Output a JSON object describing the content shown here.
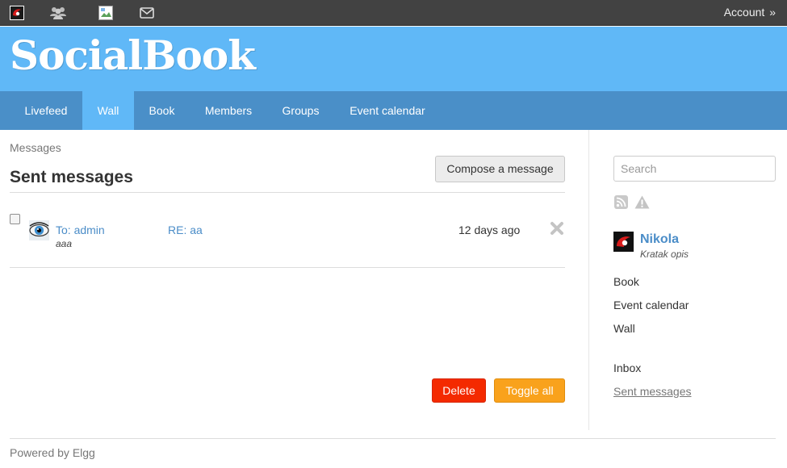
{
  "topbar": {
    "icons": [
      "site-logo-icon",
      "friends-icon",
      "broken-image-icon",
      "messages-envelope-icon"
    ],
    "account_label": "Account",
    "account_chevron": "»"
  },
  "header": {
    "logo": "SocialBook"
  },
  "nav": {
    "items": [
      {
        "label": "Livefeed",
        "active": false
      },
      {
        "label": "Wall",
        "active": true
      },
      {
        "label": "Book",
        "active": false
      },
      {
        "label": "Members",
        "active": false
      },
      {
        "label": "Groups",
        "active": false
      },
      {
        "label": "Event calendar",
        "active": false
      }
    ]
  },
  "main": {
    "breadcrumb": "Messages",
    "title": "Sent messages",
    "compose_label": "Compose a message",
    "messages": [
      {
        "to": "To: admin",
        "excerpt": "aaa",
        "subject": "RE: aa",
        "time": "12 days ago",
        "checked": false
      }
    ],
    "delete_label": "Delete",
    "toggle_label": "Toggle all"
  },
  "sidebar": {
    "search_placeholder": "Search",
    "icons": [
      "rss-icon",
      "report-warning-icon"
    ],
    "owner": {
      "name": "Nikola",
      "brief": "Kratak opis"
    },
    "links": [
      "Book",
      "Event calendar",
      "Wall"
    ],
    "message_links": [
      {
        "label": "Inbox",
        "current": false
      },
      {
        "label": "Sent messages",
        "current": true
      }
    ]
  },
  "footer": {
    "text": "Powered by Elgg"
  },
  "colors": {
    "topbar": "#424242",
    "header": "#60b8f7",
    "nav": "#4a8fc8",
    "nav_active": "#60b8f7",
    "link": "#4b8dc8",
    "delete": "#f42a00",
    "toggle": "#f9a21c"
  }
}
